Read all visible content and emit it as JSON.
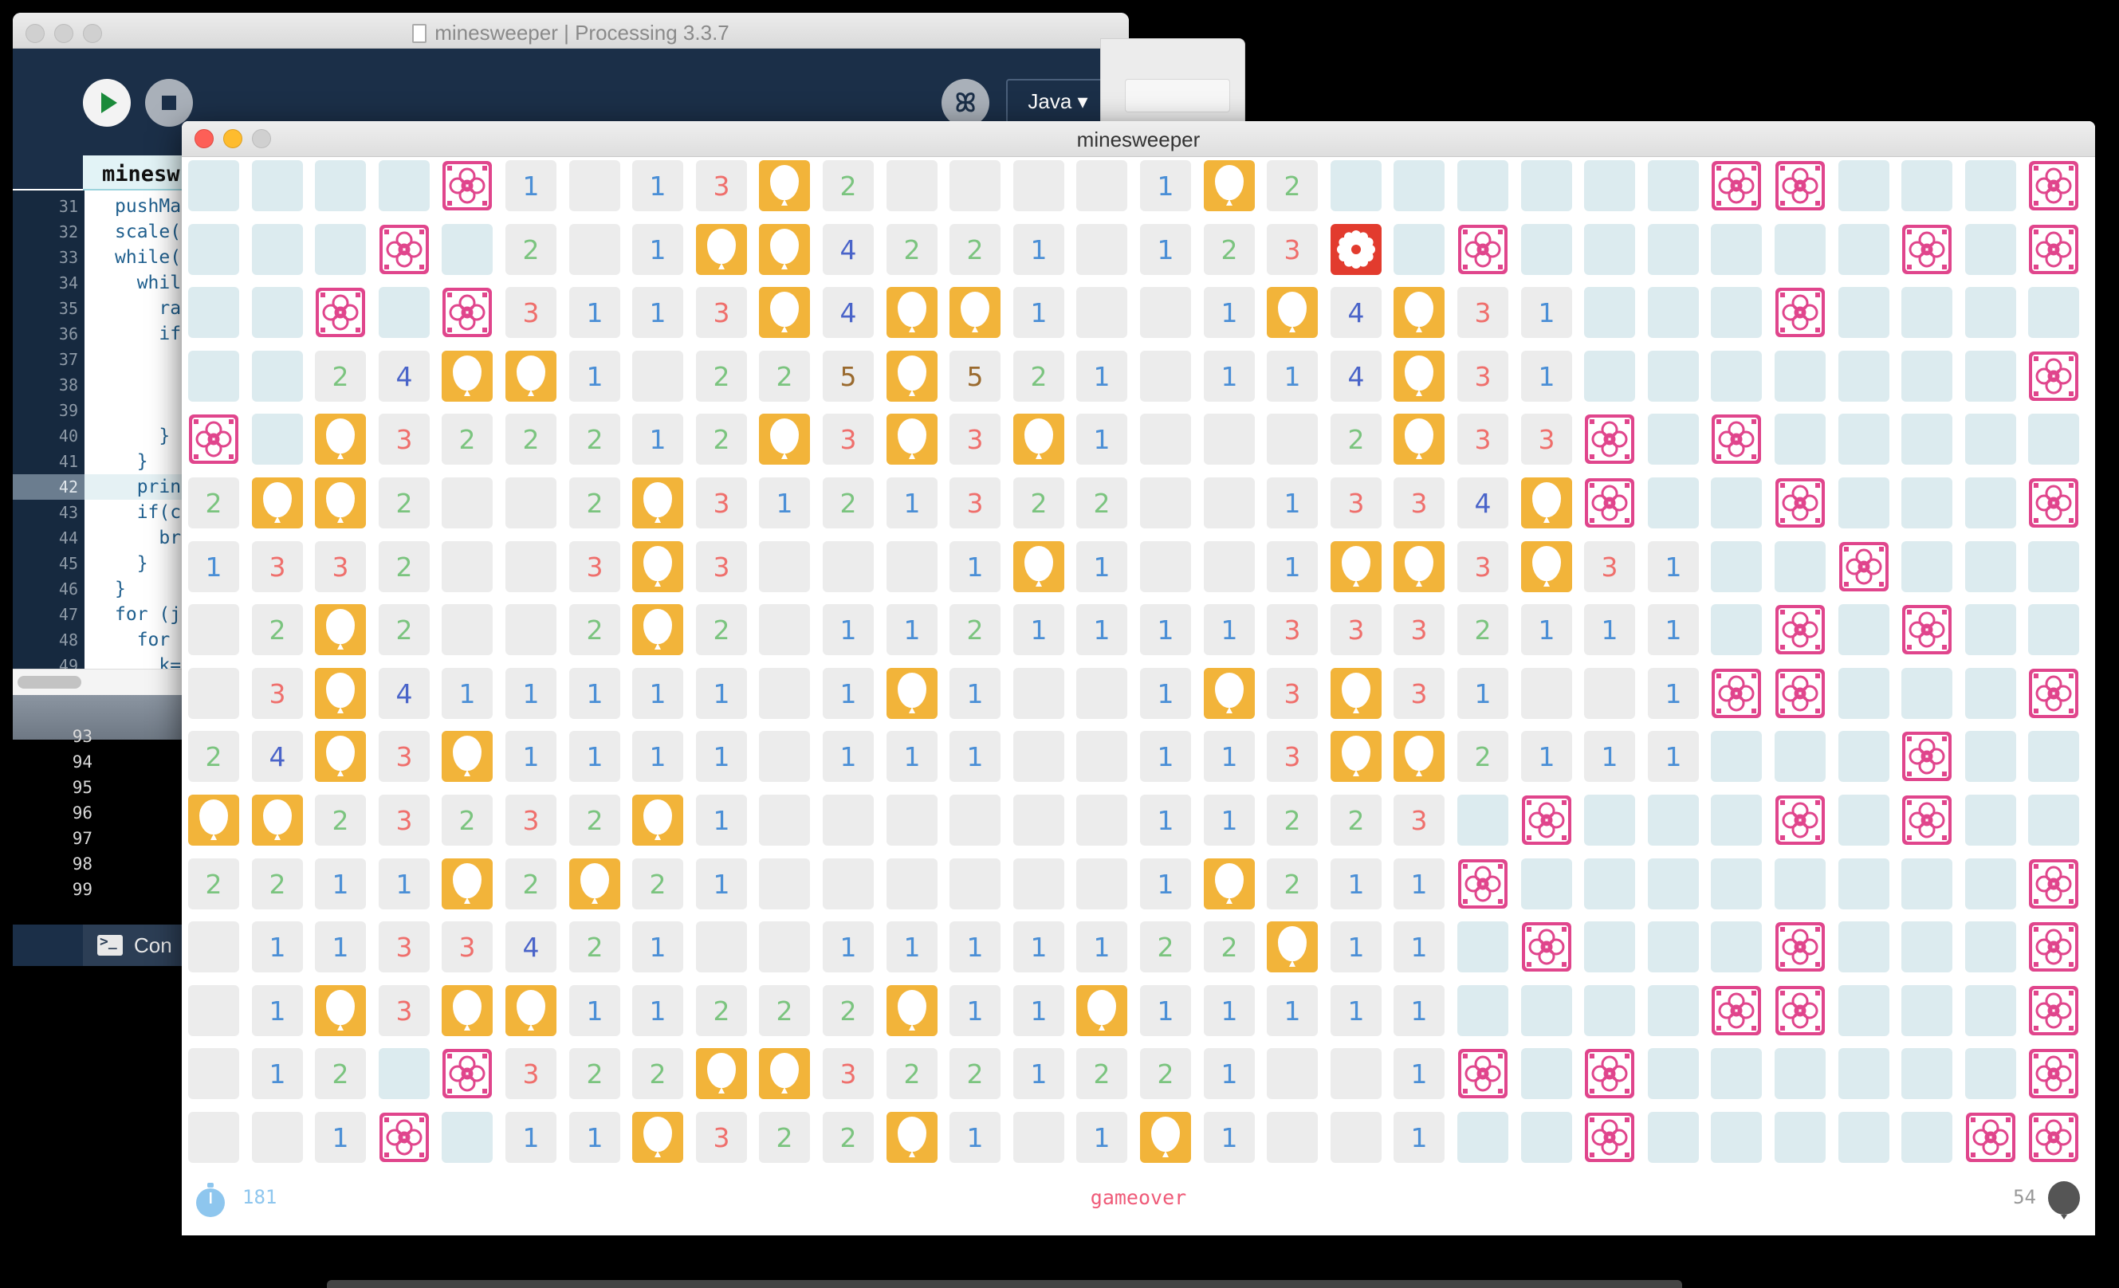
{
  "ide": {
    "title": "minesweeper | Processing 3.3.7",
    "run_label": "Run",
    "stop_label": "Stop",
    "mode": "Java ▾",
    "tab_label": "minesw",
    "lines": [
      {
        "num": "31",
        "code": "pushMa"
      },
      {
        "num": "32",
        "code": "scale("
      },
      {
        "num": "33",
        "code": "while("
      },
      {
        "num": "34",
        "code": "  whil"
      },
      {
        "num": "35",
        "code": "    ra"
      },
      {
        "num": "36",
        "code": "    if"
      },
      {
        "num": "37",
        "code": ""
      },
      {
        "num": "38",
        "code": ""
      },
      {
        "num": "39",
        "code": ""
      },
      {
        "num": "40",
        "code": "    }"
      },
      {
        "num": "41",
        "code": "  }"
      },
      {
        "num": "42",
        "code": "  prin"
      },
      {
        "num": "43",
        "code": "  if(c"
      },
      {
        "num": "44",
        "code": "    br"
      },
      {
        "num": "45",
        "code": "  }"
      },
      {
        "num": "46",
        "code": "}"
      },
      {
        "num": "47",
        "code": "for (j"
      },
      {
        "num": "48",
        "code": "  for"
      },
      {
        "num": "49",
        "code": "    k="
      }
    ],
    "highlight_line": "42",
    "console_lines": [
      "93",
      "94",
      "95",
      "96",
      "97",
      "98",
      "99"
    ],
    "console_tab": "Con"
  },
  "sketch": {
    "title": "minesweeper",
    "timer": "181",
    "status": "gameover",
    "mines_left": "54"
  },
  "board": {
    "cols": 30,
    "rows": 16,
    "legend": {
      "h": "hidden",
      "e": "open-empty",
      "b": "balloon",
      "f": "flower",
      "x": "exploded-mine",
      "1-5": "adjacent-count"
    },
    "grid": [
      [
        "h",
        "h",
        "h",
        "h",
        "f",
        "1",
        "e",
        "1",
        "3",
        "b",
        "2",
        "e",
        "e",
        "e",
        "e",
        "1",
        "b",
        "2",
        "h",
        "h",
        "h",
        "h",
        "h",
        "h",
        "f",
        "f",
        "h",
        "h",
        "h",
        "f"
      ],
      [
        "h",
        "h",
        "h",
        "f",
        "h",
        "2",
        "e",
        "1",
        "b",
        "b",
        "4",
        "2",
        "2",
        "1",
        "e",
        "1",
        "2",
        "3",
        "x",
        "h",
        "f",
        "h",
        "h",
        "h",
        "h",
        "h",
        "h",
        "f",
        "h",
        "f"
      ],
      [
        "h",
        "h",
        "f",
        "h",
        "f",
        "3",
        "1",
        "1",
        "3",
        "b",
        "4",
        "b",
        "b",
        "1",
        "e",
        "e",
        "1",
        "b",
        "4",
        "b",
        "3",
        "1",
        "h",
        "h",
        "h",
        "f",
        "h",
        "h",
        "h",
        "h"
      ],
      [
        "h",
        "h",
        "2",
        "4",
        "b",
        "b",
        "1",
        "e",
        "2",
        "2",
        "5",
        "b",
        "5",
        "2",
        "1",
        "e",
        "1",
        "1",
        "4",
        "b",
        "3",
        "1",
        "h",
        "h",
        "h",
        "h",
        "h",
        "h",
        "h",
        "f"
      ],
      [
        "f",
        "h",
        "b",
        "3",
        "2",
        "2",
        "2",
        "1",
        "2",
        "b",
        "3",
        "b",
        "3",
        "b",
        "1",
        "e",
        "e",
        "e",
        "2",
        "b",
        "3",
        "3",
        "f",
        "h",
        "f",
        "h",
        "h",
        "h",
        "h",
        "h"
      ],
      [
        "2",
        "b",
        "b",
        "2",
        "e",
        "e",
        "2",
        "b",
        "3",
        "1",
        "2",
        "1",
        "3",
        "2",
        "2",
        "e",
        "e",
        "1",
        "3",
        "3",
        "4",
        "b",
        "f",
        "h",
        "h",
        "f",
        "h",
        "h",
        "h",
        "f"
      ],
      [
        "1",
        "3",
        "3",
        "2",
        "e",
        "e",
        "3",
        "b",
        "3",
        "e",
        "e",
        "e",
        "1",
        "b",
        "1",
        "e",
        "e",
        "1",
        "b",
        "b",
        "3",
        "b",
        "3",
        "1",
        "h",
        "h",
        "f",
        "h",
        "h",
        "h"
      ],
      [
        "e",
        "2",
        "b",
        "2",
        "e",
        "e",
        "2",
        "b",
        "2",
        "e",
        "1",
        "1",
        "2",
        "1",
        "1",
        "1",
        "1",
        "3",
        "3",
        "3",
        "2",
        "1",
        "1",
        "1",
        "h",
        "f",
        "h",
        "f",
        "h",
        "h"
      ],
      [
        "e",
        "3",
        "b",
        "4",
        "1",
        "1",
        "1",
        "1",
        "1",
        "e",
        "1",
        "b",
        "1",
        "e",
        "e",
        "1",
        "b",
        "3",
        "b",
        "3",
        "1",
        "e",
        "e",
        "1",
        "f",
        "f",
        "h",
        "h",
        "h",
        "f"
      ],
      [
        "2",
        "4",
        "b",
        "3",
        "b",
        "1",
        "1",
        "1",
        "1",
        "e",
        "1",
        "1",
        "1",
        "e",
        "e",
        "1",
        "1",
        "3",
        "b",
        "b",
        "2",
        "1",
        "1",
        "1",
        "h",
        "h",
        "h",
        "f",
        "h",
        "h"
      ],
      [
        "b",
        "b",
        "2",
        "3",
        "2",
        "3",
        "2",
        "b",
        "1",
        "e",
        "e",
        "e",
        "e",
        "e",
        "e",
        "1",
        "1",
        "2",
        "2",
        "3",
        "h",
        "f",
        "h",
        "h",
        "h",
        "f",
        "h",
        "f",
        "h",
        "h"
      ],
      [
        "2",
        "2",
        "1",
        "1",
        "b",
        "2",
        "b",
        "2",
        "1",
        "e",
        "e",
        "e",
        "e",
        "e",
        "e",
        "1",
        "b",
        "2",
        "1",
        "1",
        "f",
        "h",
        "h",
        "h",
        "h",
        "h",
        "h",
        "h",
        "h",
        "f"
      ],
      [
        "e",
        "1",
        "1",
        "3",
        "3",
        "4",
        "2",
        "1",
        "e",
        "e",
        "1",
        "1",
        "1",
        "1",
        "1",
        "2",
        "2",
        "b",
        "1",
        "1",
        "h",
        "f",
        "h",
        "h",
        "h",
        "f",
        "h",
        "h",
        "h",
        "f"
      ],
      [
        "e",
        "1",
        "b",
        "3",
        "b",
        "b",
        "1",
        "1",
        "2",
        "2",
        "2",
        "b",
        "1",
        "1",
        "b",
        "1",
        "1",
        "1",
        "1",
        "1",
        "h",
        "h",
        "h",
        "h",
        "f",
        "f",
        "h",
        "h",
        "h",
        "f"
      ],
      [
        "e",
        "1",
        "2",
        "h",
        "f",
        "3",
        "2",
        "2",
        "b",
        "b",
        "3",
        "2",
        "2",
        "1",
        "2",
        "2",
        "1",
        "e",
        "e",
        "1",
        "f",
        "h",
        "f",
        "h",
        "h",
        "h",
        "h",
        "h",
        "h",
        "f"
      ],
      [
        "e",
        "e",
        "1",
        "f",
        "h",
        "1",
        "1",
        "b",
        "3",
        "2",
        "2",
        "b",
        "1",
        "e",
        "1",
        "b",
        "1",
        "e",
        "e",
        "1",
        "h",
        "h",
        "f",
        "h",
        "h",
        "h",
        "h",
        "h",
        "f",
        "f"
      ]
    ]
  },
  "colors": {
    "balloon": "#f2b43a",
    "flower": "#e0458c",
    "exploded": "#e23b2e",
    "hidden": "#dcebef",
    "open": "#ececec"
  }
}
